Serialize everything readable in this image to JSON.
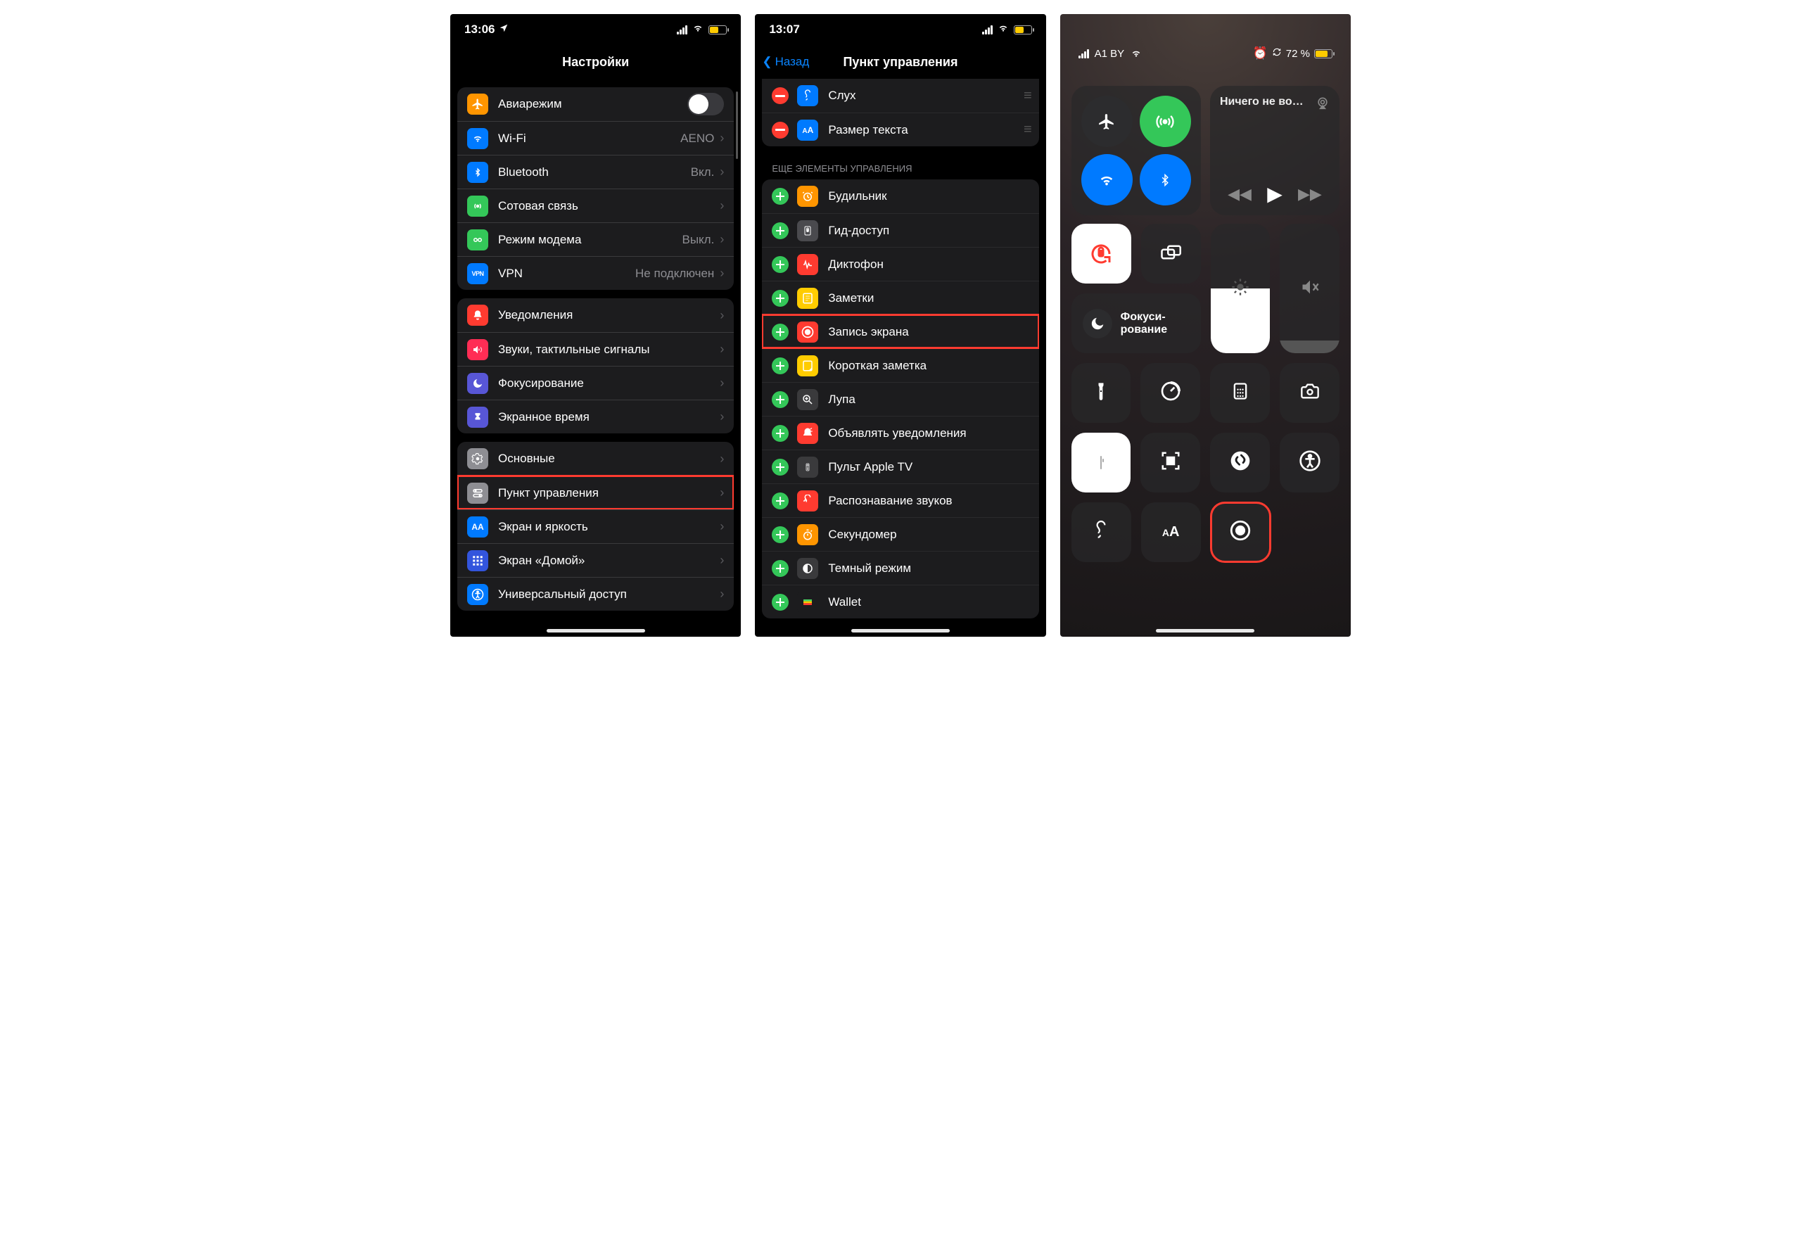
{
  "screen1": {
    "status": {
      "time": "13:06",
      "battery_pct": 50
    },
    "title": "Настройки",
    "groups": [
      [
        {
          "key": "airplane",
          "label": "Авиарежим",
          "icon_bg": "#ff9500",
          "toggle": true
        },
        {
          "key": "wifi",
          "label": "Wi-Fi",
          "value": "AENO",
          "icon_bg": "#007aff"
        },
        {
          "key": "bluetooth",
          "label": "Bluetooth",
          "value": "Вкл.",
          "icon_bg": "#007aff"
        },
        {
          "key": "cellular",
          "label": "Сотовая связь",
          "icon_bg": "#34c759"
        },
        {
          "key": "hotspot",
          "label": "Режим модема",
          "value": "Выкл.",
          "icon_bg": "#34c759"
        },
        {
          "key": "vpn",
          "label": "VPN",
          "value": "Не подключен",
          "icon_bg": "#007aff"
        }
      ],
      [
        {
          "key": "notifications",
          "label": "Уведомления",
          "icon_bg": "#ff3b30"
        },
        {
          "key": "sounds",
          "label": "Звуки, тактильные сигналы",
          "icon_bg": "#ff2d55"
        },
        {
          "key": "focus",
          "label": "Фокусирование",
          "icon_bg": "#5856d6"
        },
        {
          "key": "screentime",
          "label": "Экранное время",
          "icon_bg": "#5856d6"
        }
      ],
      [
        {
          "key": "general",
          "label": "Основные",
          "icon_bg": "#8e8e93"
        },
        {
          "key": "controlcenter",
          "label": "Пункт управления",
          "icon_bg": "#8e8e93",
          "highlight": true
        },
        {
          "key": "display",
          "label": "Экран и яркость",
          "icon_bg": "#007aff"
        },
        {
          "key": "homescreen",
          "label": "Экран «Домой»",
          "icon_bg": "#3355dd"
        },
        {
          "key": "accessibility",
          "label": "Универсальный доступ",
          "icon_bg": "#007aff"
        }
      ]
    ]
  },
  "screen2": {
    "status": {
      "time": "13:07",
      "battery_pct": 50
    },
    "back_label": "Назад",
    "title": "Пункт управления",
    "included": [
      {
        "key": "hearing",
        "label": "Слух",
        "icon_bg": "#007aff"
      },
      {
        "key": "textsize",
        "label": "Размер текста",
        "icon_bg": "#007aff"
      }
    ],
    "more_header": "ЕЩЕ ЭЛЕМЕНТЫ УПРАВЛЕНИЯ",
    "more": [
      {
        "key": "alarm",
        "label": "Будильник",
        "icon_bg": "#ff9500"
      },
      {
        "key": "guided",
        "label": "Гид-доступ",
        "icon_bg": "#4a4a4e"
      },
      {
        "key": "voicememo",
        "label": "Диктофон",
        "icon_bg": "#ff3b30"
      },
      {
        "key": "notes",
        "label": "Заметки",
        "icon_bg": "#ffcc00"
      },
      {
        "key": "screenrec",
        "label": "Запись экрана",
        "icon_bg": "#ff3b30",
        "highlight": true
      },
      {
        "key": "quicknote",
        "label": "Короткая заметка",
        "icon_bg": "#ffcc00"
      },
      {
        "key": "magnifier",
        "label": "Лупа",
        "icon_bg": "#3a3a3c"
      },
      {
        "key": "announce",
        "label": "Объявлять уведомления",
        "icon_bg": "#ff3b30"
      },
      {
        "key": "appletv",
        "label": "Пульт Apple TV",
        "icon_bg": "#3a3a3c"
      },
      {
        "key": "soundrec",
        "label": "Распознавание звуков",
        "icon_bg": "#ff3b30"
      },
      {
        "key": "stopwatch",
        "label": "Секундомер",
        "icon_bg": "#ff9500"
      },
      {
        "key": "darkmode",
        "label": "Темный режим",
        "icon_bg": "#3a3a3c"
      },
      {
        "key": "wallet",
        "label": "Wallet",
        "icon_bg": "#1c1c1e"
      }
    ]
  },
  "screen3": {
    "status": {
      "carrier": "A1 BY",
      "battery_text": "72 %"
    },
    "media_title": "Ничего не во…",
    "focus_label": "Фокуси-\nрование",
    "brightness_pct": 50,
    "volume_pct": 10,
    "tiles_row1": [
      "flashlight-icon",
      "timer-icon",
      "calculator-icon",
      "camera-icon"
    ],
    "tiles_row2": [
      "lowpower-icon",
      "qr-icon",
      "shazam-icon",
      "accessibility-icon"
    ],
    "tiles_row3": [
      "hearing-icon",
      "textsize-icon",
      "screenrecord-icon"
    ]
  }
}
